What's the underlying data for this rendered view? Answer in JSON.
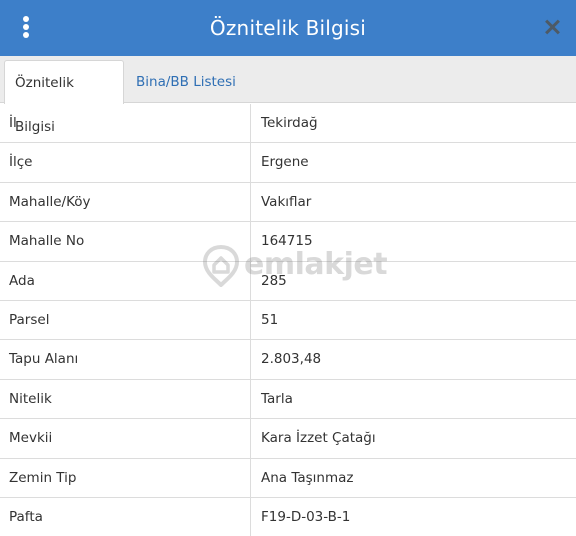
{
  "header": {
    "title": "Öznitelik Bilgisi"
  },
  "tabs": [
    {
      "label": "Öznitelik Bilgisi",
      "active": true
    },
    {
      "label": "Bina/BB Listesi",
      "active": false
    }
  ],
  "rows": [
    {
      "key": "İl",
      "value": "Tekirdağ"
    },
    {
      "key": "İlçe",
      "value": "Ergene"
    },
    {
      "key": "Mahalle/Köy",
      "value": "Vakıflar"
    },
    {
      "key": "Mahalle No",
      "value": "164715"
    },
    {
      "key": "Ada",
      "value": "285"
    },
    {
      "key": "Parsel",
      "value": "51"
    },
    {
      "key": "Tapu Alanı",
      "value": "2.803,48"
    },
    {
      "key": "Nitelik",
      "value": "Tarla"
    },
    {
      "key": "Mevkii",
      "value": "Kara İzzet Çatağı"
    },
    {
      "key": "Zemin Tip",
      "value": "Ana Taşınmaz"
    },
    {
      "key": "Pafta",
      "value": "F19-D-03-B-1"
    }
  ],
  "watermark": {
    "text": "emlakjet"
  },
  "colors": {
    "header_bg": "#3d7fc9",
    "tab_bar_bg": "#ececec",
    "link_blue": "#2f6fb4"
  },
  "icons": {
    "menu": "kebab-menu-icon",
    "close": "close-icon",
    "watermark": "location-pin-icon"
  }
}
